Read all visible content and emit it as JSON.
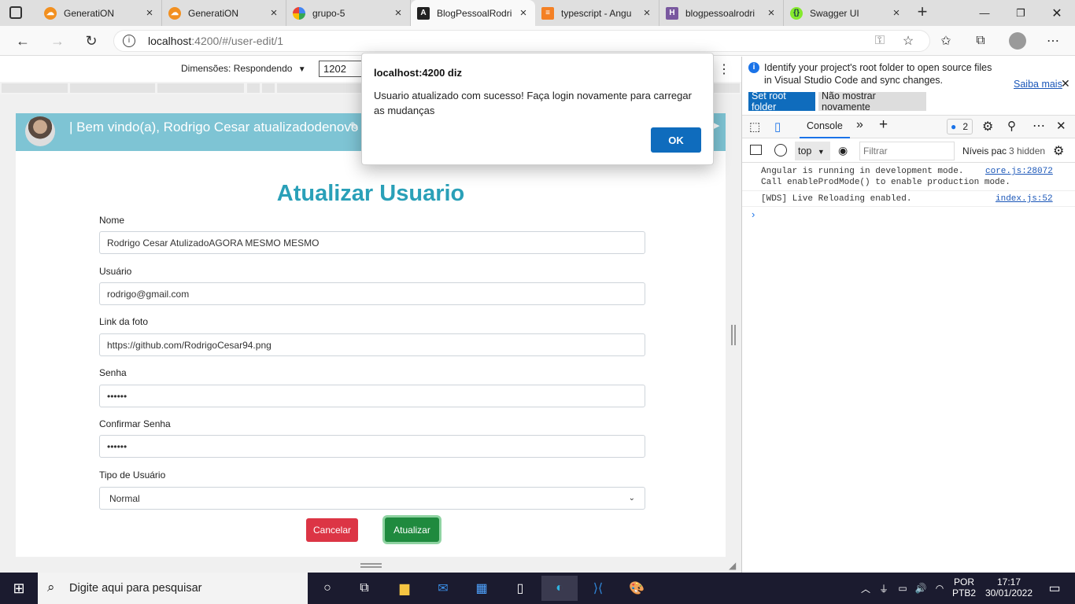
{
  "browser": {
    "tabs": [
      {
        "title": "GeneratiON",
        "active": false,
        "icon": "cloud-icon"
      },
      {
        "title": "GeneratiON",
        "active": false,
        "icon": "cloud-icon"
      },
      {
        "title": "grupo-5",
        "active": false,
        "icon": "google-icon"
      },
      {
        "title": "BlogPessoalRodri",
        "active": true,
        "icon": "angular-icon"
      },
      {
        "title": "typescript - Angu",
        "active": false,
        "icon": "stackoverflow-icon"
      },
      {
        "title": "blogpessoalrodri",
        "active": false,
        "icon": "heroku-icon"
      },
      {
        "title": "Swagger UI",
        "active": false,
        "icon": "swagger-icon"
      }
    ],
    "url_host": "localhost",
    "url_rest": ":4200/#/user-edit/1"
  },
  "device_toolbar": {
    "dimensions_label": "Dimensões: Respondendo",
    "width_value": "1202"
  },
  "app": {
    "welcome": "| Bem vindo(a), Rodrigo Cesar atualizadodenovo |",
    "title": "Atualizar Usuario",
    "fields": {
      "nome_label": "Nome",
      "nome_value": "Rodrigo Cesar AtulizadoAGORA MESMO MESMO",
      "usuario_label": "Usuário",
      "usuario_value": "rodrigo@gmail.com",
      "foto_label": "Link da foto",
      "foto_value": "https://github.com/RodrigoCesar94.png",
      "senha_label": "Senha",
      "senha_value": "••••••",
      "confirmar_label": "Confirmar Senha",
      "confirmar_value": "••••••",
      "tipo_label": "Tipo de Usuário",
      "tipo_value": "Normal"
    },
    "cancel_label": "Cancelar",
    "update_label": "Atualizar"
  },
  "dialog": {
    "title": "localhost:4200 diz",
    "message": "Usuario atualizado com sucesso! Faça login novamente para carregar as mudanças",
    "ok_label": "OK"
  },
  "devtools": {
    "info_text": "Identify your project's root folder to open source files in Visual Studio Code and sync changes.",
    "learn_more": "Saiba mais",
    "set_root": "Set root folder",
    "dont_show": "Não mostrar novamente",
    "console_tab": "Console",
    "issues_count": "2",
    "context": "top",
    "filter_placeholder": "Filtrar",
    "levels": "Níveis pac",
    "hidden": "3 hidden",
    "logs": [
      {
        "text": "Angular is running in development mode.",
        "text2": "Call enableProdMode() to enable production mode.",
        "source": "core.js:28072"
      },
      {
        "text": "[WDS] Live Reloading enabled.",
        "text2": "",
        "source": "index.js:52"
      }
    ]
  },
  "taskbar": {
    "search_placeholder": "Digite aqui para pesquisar",
    "lang1": "POR",
    "lang2": "PTB2",
    "time": "17:17",
    "date": "30/01/2022"
  },
  "colors": {
    "navbar": "#7ec4d4",
    "title": "#2aa0b8",
    "cancel": "#dc3545",
    "update": "#1f8a3e",
    "ok": "#0f6cbd"
  }
}
